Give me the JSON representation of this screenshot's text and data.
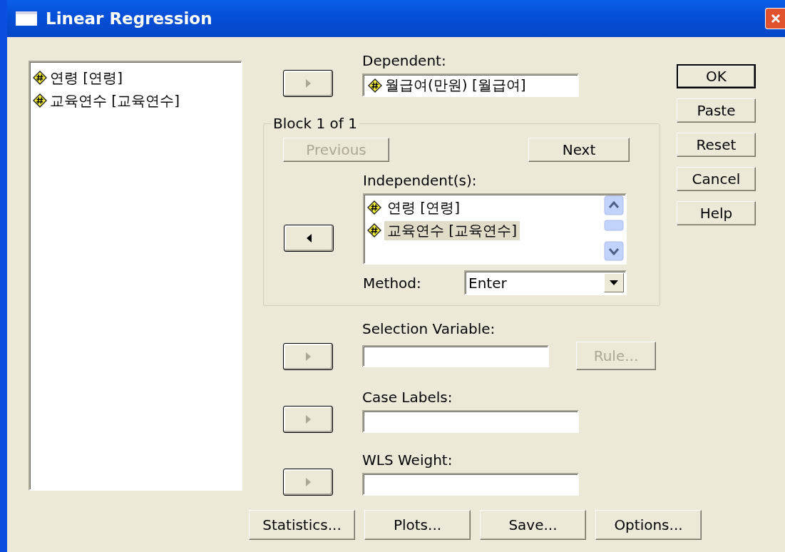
{
  "window": {
    "title": "Linear Regression"
  },
  "variables": [
    {
      "label": "연령 [연령]",
      "selected": false
    },
    {
      "label": "교육연수 [교육연수]",
      "selected": false
    }
  ],
  "dependent": {
    "label": "Dependent:",
    "arrow": {
      "kind": "add",
      "disabled": true
    },
    "items": [
      {
        "label": "월급여(만원) [월급여]"
      }
    ]
  },
  "block": {
    "title": "Block 1 of 1",
    "previous": {
      "label": "Previous",
      "disabled": true
    },
    "next": {
      "label": "Next",
      "disabled": false
    },
    "independents": {
      "label": "Independent(s):",
      "arrow": {
        "kind": "remove",
        "disabled": false
      },
      "items": [
        {
          "label": "연령 [연령]",
          "selected": false
        },
        {
          "label": "교육연수 [교육연수]",
          "selected": true
        }
      ]
    },
    "method": {
      "label": "Method:",
      "value": "Enter"
    }
  },
  "selection_variable": {
    "label": "Selection Variable:",
    "arrow": {
      "kind": "add",
      "disabled": true
    },
    "rule": {
      "label": "Rule...",
      "disabled": true
    }
  },
  "case_labels": {
    "label": "Case Labels:",
    "arrow": {
      "kind": "add",
      "disabled": true
    }
  },
  "wls_weight": {
    "label": "WLS Weight:",
    "arrow": {
      "kind": "add",
      "disabled": true
    }
  },
  "side_buttons": [
    {
      "label": "OK",
      "default": true
    },
    {
      "label": "Paste",
      "default": false
    },
    {
      "label": "Reset",
      "default": false
    },
    {
      "label": "Cancel",
      "default": false
    },
    {
      "label": "Help",
      "default": false
    }
  ],
  "bottom_buttons": [
    {
      "label": "Statistics..."
    },
    {
      "label": "Plots..."
    },
    {
      "label": "Save..."
    },
    {
      "label": "Options..."
    }
  ]
}
